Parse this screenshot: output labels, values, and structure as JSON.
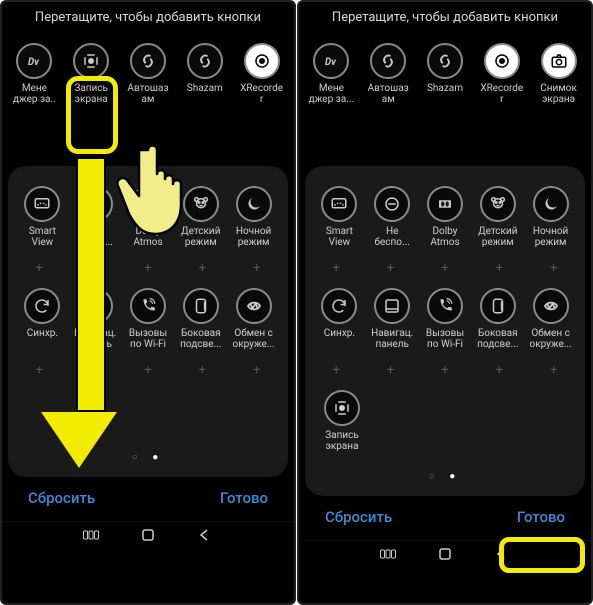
{
  "title": "Перетащите, чтобы добавить кнопки",
  "footer": {
    "reset": "Сбросить",
    "done": "Готово"
  },
  "left": {
    "top_row": [
      {
        "name": "menedzher-za",
        "label": "Мене\nджер за..",
        "icon": "dv"
      },
      {
        "name": "zapis-ekrana",
        "label": "Запись\nэкрана",
        "icon": "screenrec",
        "highlight": true
      },
      {
        "name": "avtoshazam",
        "label": "Автошаз\nам",
        "icon": "shazam"
      },
      {
        "name": "shazam",
        "label": "Shazam",
        "icon": "shazam"
      },
      {
        "name": "xrecorder",
        "label": "XRecorde\nr",
        "icon": "rec2",
        "white": true
      }
    ],
    "panel_row1": [
      {
        "name": "smart-view",
        "label": "Smart\nView",
        "icon": "smartview"
      },
      {
        "name": "ne-bespo",
        "label": "Не\nбеспо...",
        "icon": "dnd"
      },
      {
        "name": "dolby-atmos",
        "label": "Dolby\nAtmos",
        "icon": "dolby"
      },
      {
        "name": "detskiy-rezhim",
        "label": "Детский\nрежим",
        "icon": "kids"
      },
      {
        "name": "nochnoy-rezhim",
        "label": "Ночной\nрежим",
        "icon": "night"
      }
    ],
    "panel_row2": [
      {
        "name": "sinhr",
        "label": "Синхр.",
        "icon": "sync"
      },
      {
        "name": "navigats",
        "label": "Навигац.\nпанель",
        "icon": "navpanel"
      },
      {
        "name": "vyzovy-wifi",
        "label": "Вызовы\nпо Wi-Fi",
        "icon": "wificall"
      },
      {
        "name": "bokovaya",
        "label": "Боковая\nподсве...",
        "icon": "edge"
      },
      {
        "name": "obmen",
        "label": "Обмен с\nокруже...",
        "icon": "share"
      }
    ]
  },
  "right": {
    "top_row": [
      {
        "name": "menedzher-za",
        "label": "Мене\nджер за...",
        "icon": "dv"
      },
      {
        "name": "avtoshazam",
        "label": "Автошаз\nам",
        "icon": "shazam"
      },
      {
        "name": "shazam",
        "label": "Shazam",
        "icon": "shazam"
      },
      {
        "name": "xrecorder",
        "label": "XRecorde\nr",
        "icon": "rec2",
        "white": true
      },
      {
        "name": "snimok-ekrana",
        "label": "Снимок\nэкрана",
        "icon": "camera",
        "white": true
      }
    ],
    "panel_row1": [
      {
        "name": "smart-view",
        "label": "Smart\nView",
        "icon": "smartview"
      },
      {
        "name": "ne-bespo",
        "label": "Не\nбеспо...",
        "icon": "dnd"
      },
      {
        "name": "dolby-atmos",
        "label": "Dolby\nAtmos",
        "icon": "dolby"
      },
      {
        "name": "detskiy-rezhim",
        "label": "Детский\nрежим",
        "icon": "kids"
      },
      {
        "name": "nochnoy-rezhim",
        "label": "Ночной\nрежим",
        "icon": "night"
      }
    ],
    "panel_row2": [
      {
        "name": "sinhr",
        "label": "Синхр.",
        "icon": "sync"
      },
      {
        "name": "navigats",
        "label": "Навигац.\nпанель",
        "icon": "navpanel"
      },
      {
        "name": "vyzovy-wifi",
        "label": "Вызовы\nпо Wi-Fi",
        "icon": "wificall"
      },
      {
        "name": "bokovaya",
        "label": "Боковая\nподсве...",
        "icon": "edge"
      },
      {
        "name": "obmen",
        "label": "Обмен с\nокруже...",
        "icon": "share"
      }
    ],
    "panel_row3": [
      {
        "name": "zapis-ekrana-placed",
        "label": "Запись\nэкрана",
        "icon": "screenrec"
      }
    ]
  },
  "icons": {
    "dv": "<svg class='icon-svg' viewBox='0 0 24 24' fill='none' stroke='currentColor' stroke-width='2'><text x='4' y='17' font-size='13' font-style='italic' font-weight='bold' fill='currentColor' stroke='none'>Dv</text></svg>",
    "screenrec": "<svg class='icon-svg' viewBox='0 0 24 24' fill='none' stroke='currentColor' stroke-width='2'><path d='M7 4h10M7 20h10M4 7v10M20 7v10'/><circle cx='12' cy='12' r='3' fill='currentColor'/></svg>",
    "shazam": "<svg class='icon-svg' viewBox='0 0 24 24' fill='none' stroke='currentColor' stroke-width='2.5'><path d='M9 15c-3-3-3-6 0-9 2-2 5-2 6 0M15 9c3 3 3 6 0 9-2 2-5 2-6 0'/></svg>",
    "rec2": "<svg class='icon-svg' viewBox='0 0 24 24' fill='none' stroke='currentColor' stroke-width='2'><circle cx='12' cy='12' r='8'/><circle cx='12' cy='12' r='3' fill='currentColor'/></svg>",
    "camera": "<svg class='icon-svg' viewBox='0 0 24 24' fill='none' stroke='currentColor' stroke-width='2'><rect x='3' y='7' width='18' height='13' rx='2'/><circle cx='12' cy='13.5' r='3.5'/><path d='M9 7l1.5-3h3L15 7'/></svg>",
    "smartview": "<svg class='icon-svg' viewBox='0 0 24 24' fill='none' stroke='currentColor' stroke-width='2'><rect x='3' y='5' width='18' height='12' rx='2'/><path d='M6 14c3-4 9-4 12 0' stroke-dasharray='2 2'/></svg>",
    "dnd": "<svg class='icon-svg' viewBox='0 0 24 24' fill='none' stroke='currentColor' stroke-width='2'><circle cx='12' cy='12' r='8'/><line x1='7' y1='12' x2='17' y2='12'/></svg>",
    "dolby": "<svg class='icon-svg' viewBox='0 0 24 24' fill='currentColor'><rect x='4' y='7' width='16' height='10' rx='1'/><ellipse cx='9' cy='12' rx='2.2' ry='3.5' fill='#1a1a1a'/><ellipse cx='15' cy='12' rx='2.2' ry='3.5' fill='#1a1a1a'/></svg>",
    "kids": "<svg class='icon-svg' viewBox='0 0 24 24' fill='none' stroke='currentColor' stroke-width='2'><circle cx='12' cy='11' r='6'/><circle cx='6' cy='6' r='2.5'/><circle cx='18' cy='6' r='2.5'/><circle cx='9.5' cy='10' r='1' fill='currentColor'/><circle cx='14.5' cy='10' r='1' fill='currentColor'/><path d='M10 13.5c1 1 3 1 4 0'/></svg>",
    "night": "<svg class='icon-svg' viewBox='0 0 24 24' fill='currentColor'><path d='M20 14.5A8 8 0 1 1 9.5 4a6.5 6.5 0 0 0 10.5 10.5z'/></svg>",
    "sync": "<svg class='icon-svg' viewBox='0 0 24 24' fill='none' stroke='currentColor' stroke-width='2'><path d='M20 12a8 8 0 1 0-2.3 5.6M20 4v6h-6'/></svg>",
    "navpanel": "<svg class='icon-svg' viewBox='0 0 24 24' fill='none' stroke='currentColor' stroke-width='2'><rect x='4' y='4' width='16' height='16' rx='2'/><line x1='4' y1='16' x2='20' y2='16'/></svg>",
    "wificall": "<svg class='icon-svg' viewBox='0 0 24 24' fill='none' stroke='currentColor' stroke-width='2'><path d='M6 3c0 9 6 15 15 15v-4l-4-1-2 2c-3-1-5-3-6-6l2-2-1-4H6z' fill='currentColor' stroke='none'/><path d='M14 5c2 0 4 2 4 4M14 2c4 0 7 3 7 7' stroke-width='1.5'/></svg>",
    "edge": "<svg class='icon-svg' viewBox='0 0 24 24' fill='none' stroke='currentColor' stroke-width='2'><rect x='6' y='3' width='12' height='18' rx='3'/><path d='M17 6v12' stroke-width='2.5'/></svg>",
    "share": "<svg class='icon-svg' viewBox='0 0 24 24' fill='none' stroke='currentColor' stroke-width='2.5'><path d='M4 12c3-6 13-6 16 0-3 6-13 6-16 0z M7 9l3 6M14 9l3 6M10 15l4-6'/></svg>"
  }
}
